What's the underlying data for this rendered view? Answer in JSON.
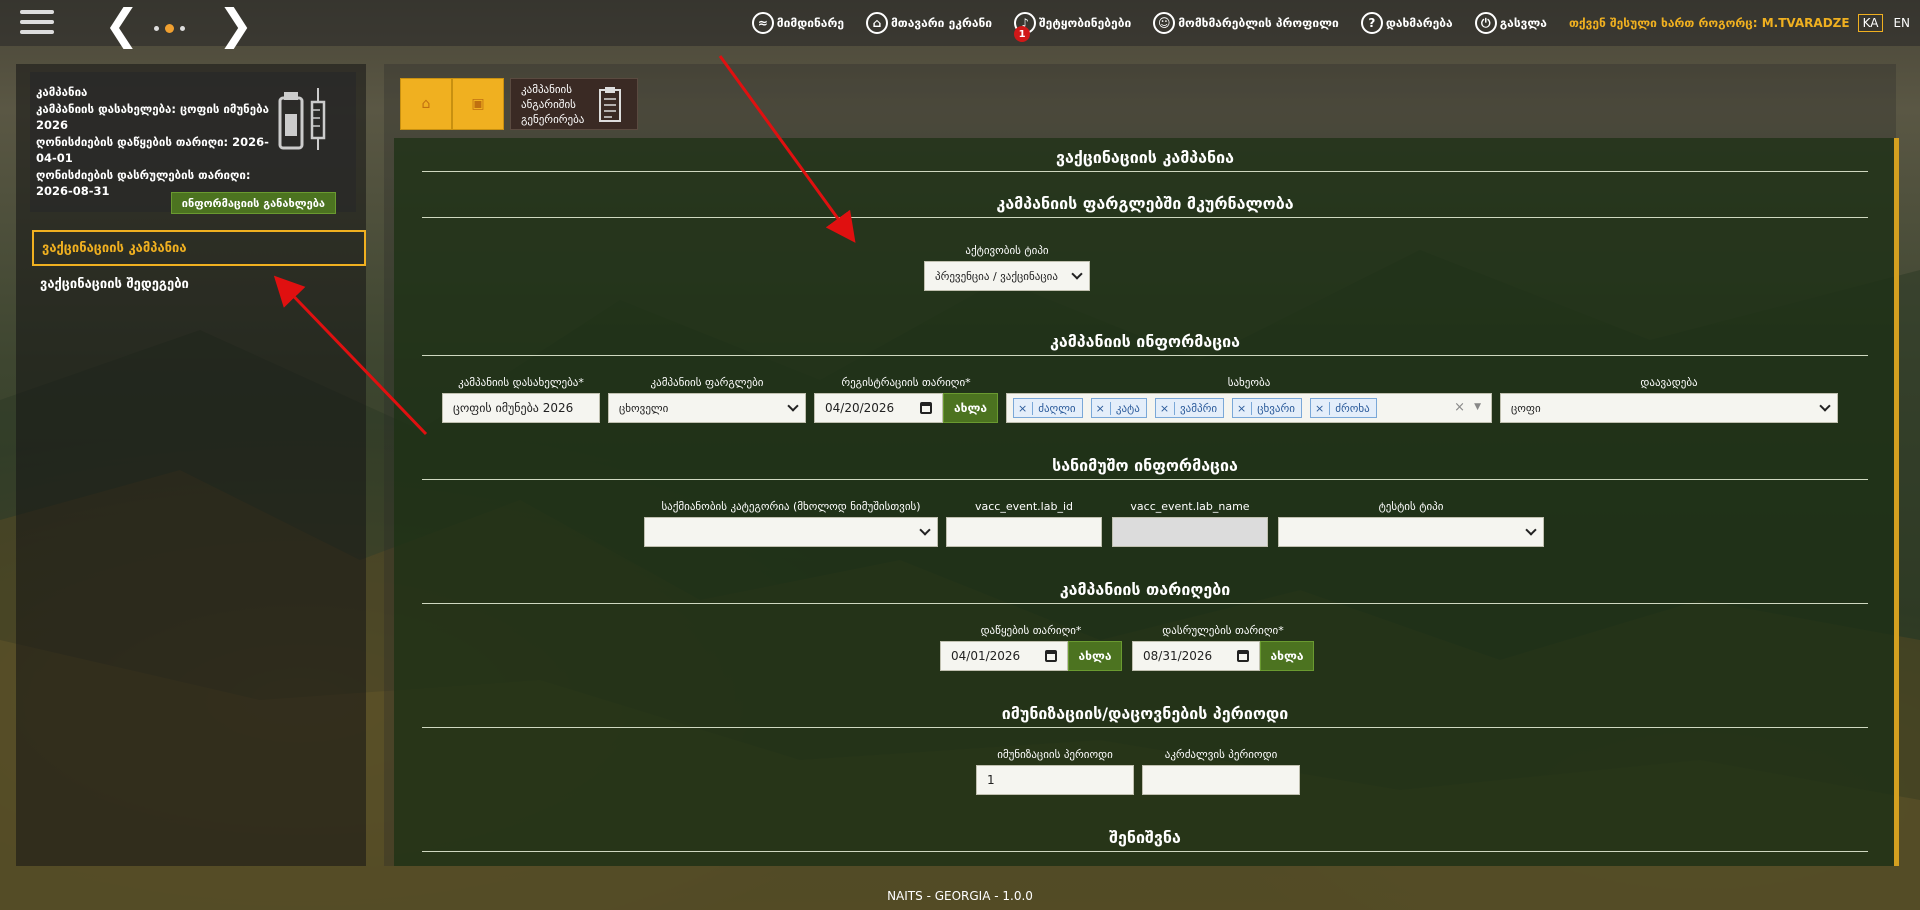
{
  "topbar": {
    "items": [
      {
        "icon": "monitoring-icon",
        "label": "მიმდინარე"
      },
      {
        "icon": "home-icon",
        "label": "მთავარი ეკრანი"
      },
      {
        "icon": "bell-icon",
        "label": "შეტყობინებები",
        "badge": "1"
      },
      {
        "icon": "user-icon",
        "label": "მომხმარებლის პროფილი"
      },
      {
        "icon": "help-icon",
        "label": "დახმარება"
      },
      {
        "icon": "power-icon",
        "label": "გასვლა"
      }
    ],
    "user_text": "თქვენ შესული ხართ როგორც: M.TVARADZE",
    "lang_ka": "KA",
    "lang_en": "EN"
  },
  "sidebar": {
    "campaign_card": {
      "line1": "კამპანია",
      "line2": "კამპანიის დასახელება: ცოფის იმუნება 2026",
      "line3": "ღონისძიების დაწყების თარიღი: 2026-04-01",
      "line4": "ღონისძიების დასრულების თარიღი: 2026-08-31",
      "info_button": "ინფორმაციის განახლება"
    },
    "menu": [
      {
        "label": "ვაქცინაციის კამპანია",
        "active": true
      },
      {
        "label": "ვაქცინაციის შედეგები",
        "active": false
      }
    ]
  },
  "main": {
    "report_button": "კამპანიის ანგარიშის გენერირება",
    "titles": {
      "main": "ვაქცინაციის კამპანია",
      "coverage": "კამპანიის ფარგლებში მკურნალობა",
      "campaign_info": "კამპანიის ინფორმაცია",
      "sample_info": "სანიმუშო ინფორმაცია",
      "dates": "კამპანიის თარიღები",
      "period": "იმუნიზაციის/დაცოვნების პერიოდი",
      "note": "შენიშვნა"
    },
    "activity": {
      "label": "აქტივობის ტიპი",
      "value": "პრევენცია / ვაქცინაცია"
    },
    "campaign_info": {
      "name_label": "კამპანიის დასახელება*",
      "name_value": "ცოფის იმუნება 2026",
      "scope_label": "კამპანიის ფარგლები",
      "scope_value": "ცხოველი",
      "reg_date_label": "რეგისტრაციის თარიღი*",
      "reg_date_value": "04/20/2026",
      "now_label": "ახლა",
      "species_label": "სახეობა",
      "species_tags": [
        "ძაღლი",
        "კატა",
        "ვამპრი",
        "ცხვარი",
        "ძროხა"
      ],
      "disease_label": "დაავადება",
      "disease_value": "ცოფი"
    },
    "sample_info": {
      "category_label": "საქმიანობის კატეგორია (მხოლოდ ნიმუშისთვის)",
      "lab_id_label": "vacc_event.lab_id",
      "lab_name_label": "vacc_event.lab_name",
      "test_type_label": "ტესტის ტიპი"
    },
    "dates": {
      "start_label": "დაწყების თარიღი*",
      "start_value": "04/01/2026",
      "end_label": "დასრულების თარიღი*",
      "end_value": "08/31/2026",
      "now_label": "ახლა"
    },
    "period": {
      "imm_label": "იმუნიზაციის პერიოდი",
      "imm_value": "1",
      "ban_label": "აკრძალვის პერიოდი",
      "ban_value": ""
    }
  },
  "footer": "NAITS - GEORGIA - 1.0.0"
}
